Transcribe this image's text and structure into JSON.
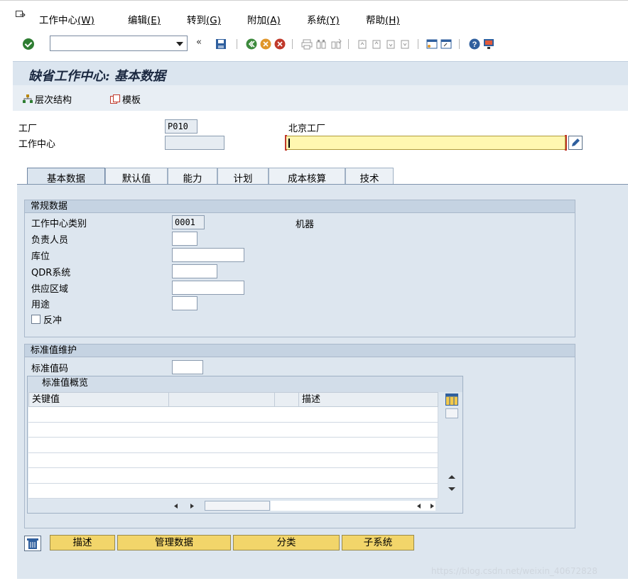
{
  "menubar": {
    "items": [
      {
        "label": "工作中心",
        "accel": "(W)"
      },
      {
        "label": "编辑",
        "accel": "(E)"
      },
      {
        "label": "转到",
        "accel": "(G)"
      },
      {
        "label": "附加",
        "accel": "(A)"
      },
      {
        "label": "系统",
        "accel": "(Y)"
      },
      {
        "label": "帮助",
        "accel": "(H)"
      }
    ]
  },
  "toolbar": {
    "command_field_value": "",
    "chevron": "«"
  },
  "title": "缺省工作中心: 基本数据",
  "app_toolbar": {
    "hierarchy_label": "层次结构",
    "template_label": "模板"
  },
  "header": {
    "plant_label": "工厂",
    "plant_value": "P010",
    "plant_name": "北京工厂",
    "workcenter_label": "工作中心",
    "workcenter_value": "",
    "description_value": ""
  },
  "tabs": [
    {
      "label": "基本数据",
      "active": true
    },
    {
      "label": "默认值",
      "active": false
    },
    {
      "label": "能力",
      "active": false
    },
    {
      "label": "计划",
      "active": false
    },
    {
      "label": "成本核算",
      "active": false
    },
    {
      "label": "技术",
      "active": false
    }
  ],
  "general": {
    "title": "常规数据",
    "category_label": "工作中心类别",
    "category_value": "0001",
    "category_text": "机器",
    "person_label": "负责人员",
    "person_value": "",
    "storage_label": "库位",
    "storage_value": "",
    "qdr_label": "QDR系统",
    "qdr_value": "",
    "supply_label": "供应区域",
    "supply_value": "",
    "usage_label": "用途",
    "usage_value": "",
    "backflush_label": "反冲",
    "backflush_checked": false
  },
  "standard": {
    "title": "标准值维护",
    "key_label": "标准值码",
    "key_value": "",
    "overview_title": "标准值概览",
    "col_key": "关键值",
    "col_blank": "",
    "col_desc": "描述",
    "rows": 6
  },
  "buttons": {
    "desc": "描述",
    "admin": "管理数据",
    "classify": "分类",
    "subsystem": "子系统"
  },
  "watermark": "https://blog.csdn.net/weixin_40672828",
  "colors": {
    "panel_bg": "#dde6ef",
    "title_bg": "#dbe5ef",
    "input_highlight": "#fff7b0",
    "button_yellow": "#f2d56a"
  }
}
